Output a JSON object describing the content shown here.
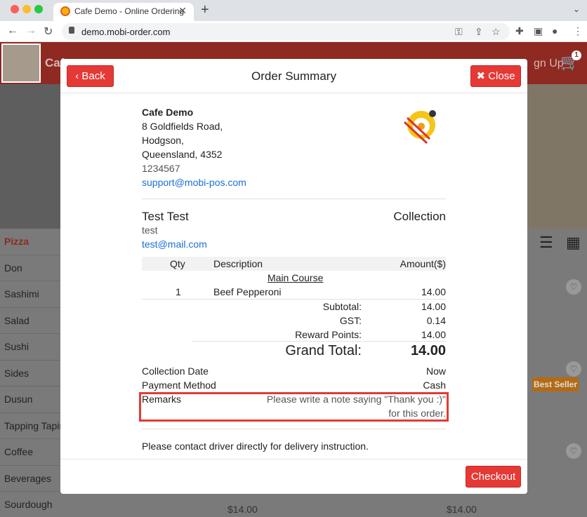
{
  "browser": {
    "tab_title": "Cafe Demo - Online Ordering",
    "tab_close": "✕",
    "new_tab": "+",
    "url": "demo.mobi-order.com"
  },
  "site": {
    "brand": "Cafe",
    "signup": "gn Up",
    "cart_count": "1",
    "categories": [
      "Pizza",
      "Don",
      "Sashimi",
      "Salad",
      "Sushi",
      "Sides",
      "Dusun",
      "Tapping Tapin",
      "Coffee",
      "Beverages",
      "Sourdough"
    ],
    "best_seller": "Best Seller",
    "price_left": "$14.00",
    "price_right": "$14.00"
  },
  "modal": {
    "title": "Order Summary",
    "back_label": "Back",
    "close_label": "Close",
    "checkout_label": "Checkout"
  },
  "merchant": {
    "name": "Cafe Demo",
    "address1": "8 Goldfields Road,",
    "address2": "Hodgson,",
    "address3": "Queensland, 4352",
    "phone": "1234567",
    "email": "support@mobi-pos.com"
  },
  "customer": {
    "name": "Test Test",
    "order_type": "Collection",
    "note": "test",
    "email": "test@mail.com"
  },
  "items_table": {
    "headers": {
      "qty": "Qty",
      "description": "Description",
      "amount": "Amount($)"
    },
    "section": "Main Course",
    "rows": [
      {
        "qty": "1",
        "description": "Beef Pepperoni",
        "amount": "14.00"
      }
    ]
  },
  "totals": {
    "subtotal_label": "Subtotal:",
    "subtotal": "14.00",
    "gst_label": "GST:",
    "gst": "0.14",
    "reward_label": "Reward Points:",
    "reward": "14.00",
    "grand_label": "Grand Total:",
    "grand": "14.00"
  },
  "details": {
    "collection_date_label": "Collection Date",
    "collection_date": "Now",
    "payment_label": "Payment Method",
    "payment": "Cash",
    "remarks_label": "Remarks",
    "remarks_line1": "Please write a note saying \"Thank you :)\"",
    "remarks_line2": "for this order."
  },
  "footer_note": "Please contact driver directly for delivery instruction.",
  "colors": {
    "accent": "#e53935",
    "link": "#1a6fd6",
    "header": "#8e2a22"
  }
}
